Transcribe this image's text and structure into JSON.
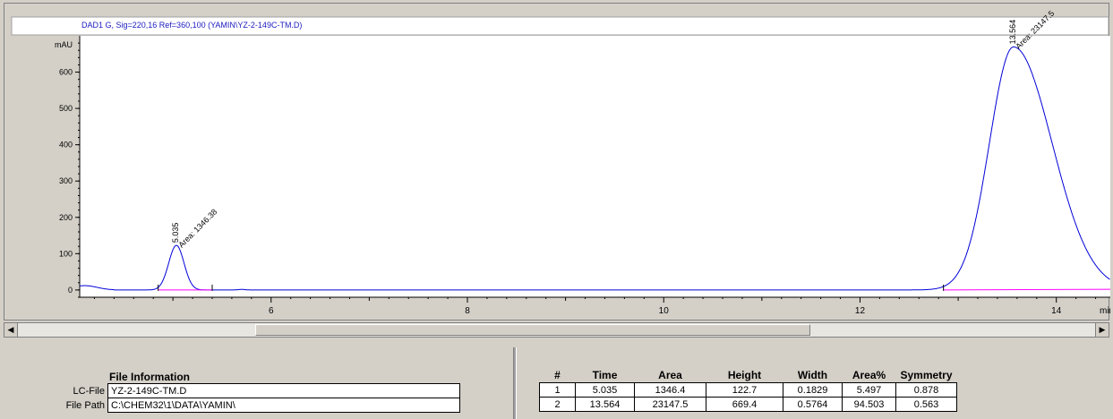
{
  "chart_data": {
    "type": "line",
    "title": "DAD1 G, Sig=220,16 Ref=360,100 (YAMIN\\YZ-2-149C-TM.D)",
    "ylabel": "mAU",
    "xlabel": "min",
    "xlim": [
      4.05,
      14.55
    ],
    "ylim": [
      -20,
      700
    ],
    "x_ticks": [
      6,
      8,
      10,
      12,
      14
    ],
    "y_ticks": [
      0,
      100,
      200,
      300,
      400,
      500,
      600
    ],
    "peaks": [
      {
        "rt": 5.035,
        "height": 122.7,
        "sigma": 0.078,
        "rt_label": "5.035",
        "area_label": "Area: 1346.38"
      },
      {
        "rt": 13.564,
        "height": 669.4,
        "sigma": 0.245,
        "tail": 1.6,
        "rt_label": "13.564",
        "area_label": "Area: 23147.5"
      }
    ],
    "grid": false,
    "colors": {
      "signal": "#0000d8",
      "baseline": "#ff00ff",
      "axis": "#000000"
    }
  },
  "table": {
    "headers": [
      "#",
      "Time",
      "Area",
      "Height",
      "Width",
      "Area%",
      "Symmetry"
    ],
    "rows": [
      [
        "1",
        "5.035",
        "1346.4",
        "122.7",
        "0.1829",
        "5.497",
        "0.878"
      ],
      [
        "2",
        "13.564",
        "23147.5",
        "669.4",
        "0.5764",
        "94.503",
        "0.563"
      ]
    ]
  },
  "file_info": {
    "title": "File Information",
    "lc_file_label": "LC-File",
    "lc_file_value": "YZ-2-149C-TM.D",
    "file_path_label": "File Path",
    "file_path_value": "C:\\CHEM32\\1\\DATA\\YAMIN\\"
  }
}
